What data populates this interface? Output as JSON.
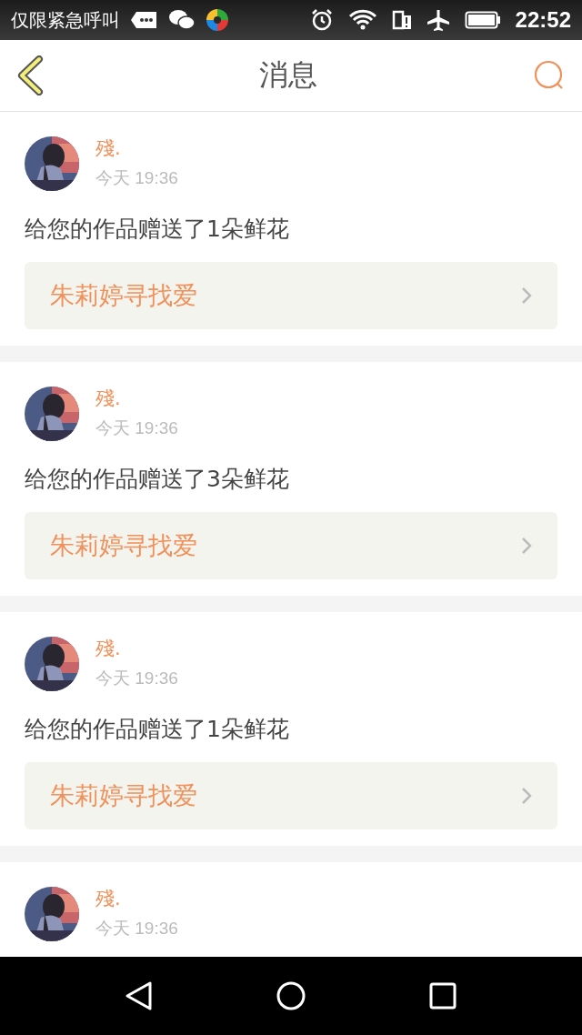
{
  "status_bar": {
    "carrier": "仅限紧急呼叫",
    "time": "22:52"
  },
  "header": {
    "title": "消息"
  },
  "messages": [
    {
      "name": "殘.",
      "time": "今天 19:36",
      "text": "给您的作品赠送了1朵鲜花",
      "work": "朱莉婷寻找爱"
    },
    {
      "name": "殘.",
      "time": "今天 19:36",
      "text": "给您的作品赠送了3朵鲜花",
      "work": "朱莉婷寻找爱"
    },
    {
      "name": "殘.",
      "time": "今天 19:36",
      "text": "给您的作品赠送了1朵鲜花",
      "work": "朱莉婷寻找爱"
    },
    {
      "name": "殘.",
      "time": "今天 19:36"
    }
  ]
}
